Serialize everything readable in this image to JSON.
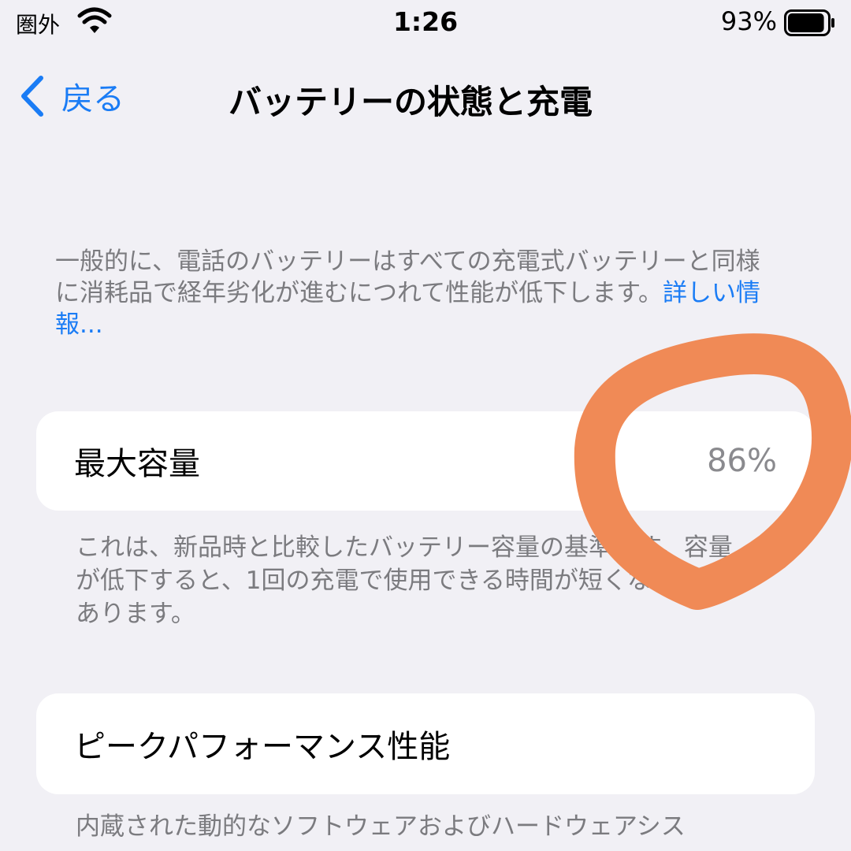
{
  "status_bar": {
    "carrier": "圏外",
    "time": "1:26",
    "battery_percent": "93%",
    "battery_level": 0.93,
    "icons": [
      "wifi-icon",
      "battery-icon"
    ]
  },
  "nav": {
    "back_label": "戻る",
    "back_icon": "chevron-left-icon",
    "title": "バッテリーの状態と充電"
  },
  "intro": {
    "text": "一般的に、電話のバッテリーはすべての充電式バッテリーと同様に消耗品で経年劣化が進むにつれて性能が低下します。",
    "link": "詳しい情報..."
  },
  "capacity": {
    "label": "最大容量",
    "value": "86%",
    "footnote": "これは、新品時と比較したバッテリー容量の基準です。容量が低下すると、1回の充電で使用できる時間が短くなることがあります。"
  },
  "peak": {
    "label": "ピークパフォーマンス性能",
    "footnote": "内蔵された動的なソフトウェアおよびハードウェアシス"
  },
  "colors": {
    "accent": "#1a7cf5",
    "background": "#f1f0f5",
    "annotation": "#f08a56"
  }
}
